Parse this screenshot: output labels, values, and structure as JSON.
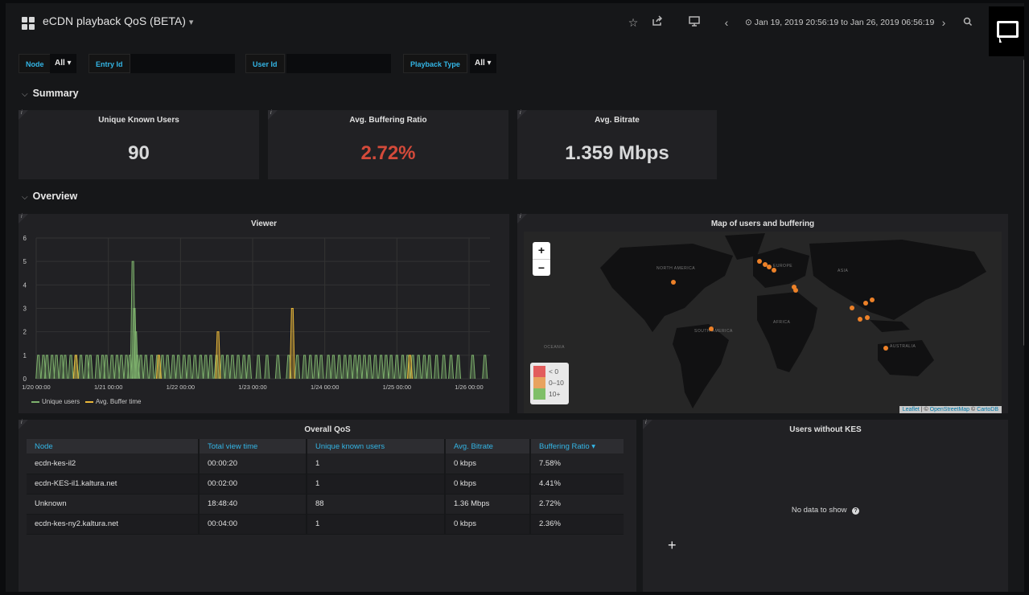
{
  "header": {
    "title": "eCDN playback QoS (BETA)",
    "title_caret": "▾",
    "time_range": "Jan 19, 2019 20:56:19 to Jan 26, 2019 06:56:19",
    "icons": [
      "star-icon",
      "share-icon",
      "tv-icon",
      "chevron-left-icon",
      "clock-icon",
      "chevron-right-icon",
      "search-icon",
      "chat-icon"
    ]
  },
  "variables": {
    "node": {
      "label": "Node",
      "value": "All ▾"
    },
    "entry_id": {
      "label": "Entry Id",
      "value": ""
    },
    "user_id": {
      "label": "User Id",
      "value": ""
    },
    "playback_type": {
      "label": "Playback Type",
      "value": "All ▾"
    }
  },
  "rows": {
    "summary": "Summary",
    "overview": "Overview",
    "chevron": "⌵"
  },
  "stats": [
    {
      "title": "Unique Known Users",
      "value": "90",
      "color": "#d8d9da"
    },
    {
      "title": "Avg. Buffering Ratio",
      "value": "2.72%",
      "color": "#d44a3a"
    },
    {
      "title": "Avg. Bitrate",
      "value": "1.359 Mbps",
      "color": "#d8d9da"
    }
  ],
  "viewer": {
    "title": "Viewer",
    "legend": [
      {
        "name": "Unique users",
        "color": "#7eb26d"
      },
      {
        "name": "Avg. Buffer time",
        "color": "#eab839"
      }
    ]
  },
  "chart_data": {
    "type": "line",
    "title": "Viewer",
    "x_ticks": [
      "1/20 00:00",
      "1/21 00:00",
      "1/22 00:00",
      "1/23 00:00",
      "1/24 00:00",
      "1/25 00:00",
      "1/26 00:00"
    ],
    "ylim": [
      0,
      6
    ],
    "y_ticks": [
      0,
      1,
      2,
      3,
      4,
      5,
      6
    ],
    "xlim_days": [
      0,
      6.29
    ],
    "series": [
      {
        "name": "Unique users",
        "color": "#7eb26d",
        "spikes": [
          [
            0.03,
            1
          ],
          [
            0.1,
            1
          ],
          [
            0.15,
            1
          ],
          [
            0.22,
            1
          ],
          [
            0.28,
            1
          ],
          [
            0.35,
            1
          ],
          [
            0.4,
            1
          ],
          [
            0.48,
            1
          ],
          [
            0.55,
            1
          ],
          [
            0.62,
            1
          ],
          [
            0.7,
            1
          ],
          [
            0.75,
            1
          ],
          [
            0.85,
            1
          ],
          [
            0.92,
            1
          ],
          [
            0.97,
            1
          ],
          [
            1.05,
            1
          ],
          [
            1.12,
            1
          ],
          [
            1.18,
            1
          ],
          [
            1.25,
            1
          ],
          [
            1.3,
            1
          ],
          [
            1.34,
            5
          ],
          [
            1.36,
            3
          ],
          [
            1.38,
            2
          ],
          [
            1.4,
            1
          ],
          [
            1.45,
            1
          ],
          [
            1.52,
            1
          ],
          [
            1.6,
            1
          ],
          [
            1.68,
            1
          ],
          [
            1.75,
            1
          ],
          [
            1.82,
            1
          ],
          [
            1.9,
            1
          ],
          [
            1.97,
            1
          ],
          [
            2.05,
            1
          ],
          [
            2.12,
            1
          ],
          [
            2.2,
            1
          ],
          [
            2.28,
            1
          ],
          [
            2.35,
            1
          ],
          [
            2.42,
            1
          ],
          [
            2.5,
            1
          ],
          [
            2.58,
            1
          ],
          [
            2.65,
            1
          ],
          [
            2.72,
            1
          ],
          [
            2.8,
            1
          ],
          [
            2.88,
            1
          ],
          [
            2.95,
            1
          ],
          [
            3.08,
            1
          ],
          [
            3.2,
            1
          ],
          [
            3.35,
            1
          ],
          [
            3.5,
            1
          ],
          [
            3.62,
            1
          ],
          [
            3.72,
            1
          ],
          [
            3.8,
            1
          ],
          [
            3.88,
            1
          ],
          [
            3.95,
            1
          ],
          [
            4.05,
            1
          ],
          [
            4.12,
            1
          ],
          [
            4.2,
            1
          ],
          [
            4.28,
            1
          ],
          [
            4.35,
            1
          ],
          [
            4.42,
            1
          ],
          [
            4.48,
            1
          ],
          [
            4.55,
            1
          ],
          [
            4.62,
            1
          ],
          [
            4.7,
            1
          ],
          [
            4.78,
            1
          ],
          [
            4.85,
            1
          ],
          [
            4.92,
            1
          ],
          [
            5.0,
            1
          ],
          [
            5.08,
            1
          ],
          [
            5.15,
            1
          ],
          [
            5.22,
            1
          ],
          [
            5.3,
            1
          ],
          [
            5.38,
            1
          ],
          [
            5.45,
            1
          ],
          [
            5.55,
            1
          ],
          [
            5.65,
            1
          ],
          [
            5.75,
            1
          ],
          [
            5.85,
            1
          ],
          [
            6.05,
            1
          ],
          [
            6.22,
            1
          ]
        ]
      },
      {
        "name": "Avg. Buffer time",
        "color": "#eab839",
        "spikes": [
          [
            2.52,
            2
          ],
          [
            3.55,
            3
          ],
          [
            5.18,
            1
          ],
          [
            1.7,
            1
          ],
          [
            0.55,
            1
          ]
        ]
      }
    ]
  },
  "map": {
    "title": "Map of users and buffering",
    "zoom_in": "+",
    "zoom_out": "−",
    "legend": [
      {
        "label": "< 0",
        "color": "#e25d5d"
      },
      {
        "label": "0–10",
        "color": "#e8a35e"
      },
      {
        "label": "10+",
        "color": "#7fbf68"
      }
    ],
    "attribution_links": [
      "Leaflet",
      "OpenStreetMap",
      "CartoDB"
    ],
    "attribution_sep": "|",
    "attribution_copy": "©",
    "regions": [
      "NORTH AMERICA",
      "SOUTH AMERICA",
      "EUROPE",
      "AFRICA",
      "ASIA",
      "AUSTRALIA",
      "OCEANIA"
    ],
    "dot_color": "#ed8128"
  },
  "qos": {
    "title": "Overall QoS",
    "columns": [
      "Node",
      "Total view time",
      "Unique known users",
      "Avg. Bitrate",
      "Buffering Ratio ▾"
    ],
    "rows": [
      [
        "ecdn-kes-il2",
        "00:00:20",
        "1",
        "0 kbps",
        "7.58%"
      ],
      [
        "ecdn-KES-il1.kaltura.net",
        "00:02:00",
        "1",
        "0 kbps",
        "4.41%"
      ],
      [
        "Unknown",
        "18:48:40",
        "88",
        "1.36 Mbps",
        "2.72%"
      ],
      [
        "ecdn-kes-ny2.kaltura.net",
        "00:04:00",
        "1",
        "0 kbps",
        "2.36%"
      ]
    ]
  },
  "no_kes": {
    "title": "Users without KES",
    "message": "No data to show",
    "help_icon": "?",
    "plus": "+"
  },
  "panel_info": "i"
}
